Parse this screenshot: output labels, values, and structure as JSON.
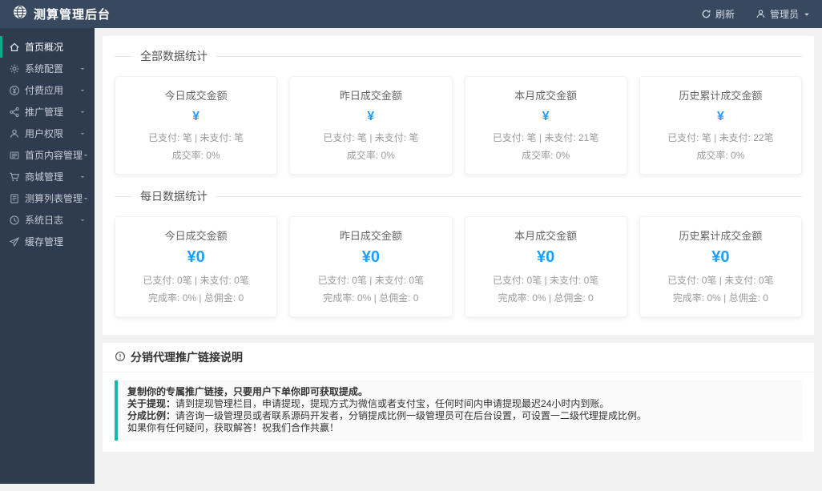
{
  "header": {
    "title": "测算管理后台",
    "refresh_label": "刷新",
    "user_label": "管理员"
  },
  "sidebar": {
    "items": [
      {
        "label": "首页概况",
        "icon": "home-icon",
        "active": true,
        "has_children": false
      },
      {
        "label": "系统配置",
        "icon": "gear-icon",
        "active": false,
        "has_children": true
      },
      {
        "label": "付费应用",
        "icon": "pay-icon",
        "active": false,
        "has_children": true
      },
      {
        "label": "推广管理",
        "icon": "share-icon",
        "active": false,
        "has_children": true
      },
      {
        "label": "用户权限",
        "icon": "user-icon",
        "active": false,
        "has_children": true
      },
      {
        "label": "首页内容管理",
        "icon": "content-icon",
        "active": false,
        "has_children": true
      },
      {
        "label": "商城管理",
        "icon": "cart-icon",
        "active": false,
        "has_children": true
      },
      {
        "label": "测算列表管理",
        "icon": "list-icon",
        "active": false,
        "has_children": true
      },
      {
        "label": "系统日志",
        "icon": "clock-icon",
        "active": false,
        "has_children": true
      },
      {
        "label": "缓存管理",
        "icon": "send-icon",
        "active": false,
        "has_children": false
      }
    ]
  },
  "stats_all": {
    "section_title": "全部数据统计",
    "cards": [
      {
        "title": "今日成交金额",
        "amount": "¥",
        "line1": "已支付: 笔 | 未支付: 笔",
        "line2": "成交率: 0%"
      },
      {
        "title": "昨日成交金额",
        "amount": "¥",
        "line1": "已支付: 笔 | 未支付: 笔",
        "line2": "成交率: 0%"
      },
      {
        "title": "本月成交金额",
        "amount": "¥",
        "line1": "已支付: 笔 | 未支付: 21笔",
        "line2": "成交率: 0%"
      },
      {
        "title": "历史累计成交金额",
        "amount": "¥",
        "line1": "已支付: 笔 | 未支付: 22笔",
        "line2": "成交率: 0%"
      }
    ]
  },
  "stats_daily": {
    "section_title": "每日数据统计",
    "cards": [
      {
        "title": "今日成交金额",
        "amount": "¥0",
        "line1": "已支付: 0笔 | 未支付: 0笔",
        "line2": "完成率: 0% | 总佣金: 0"
      },
      {
        "title": "昨日成交金额",
        "amount": "¥0",
        "line1": "已支付: 0笔 | 未支付: 0笔",
        "line2": "完成率: 0% | 总佣金: 0"
      },
      {
        "title": "本月成交金额",
        "amount": "¥0",
        "line1": "已支付: 0笔 | 未支付: 0笔",
        "line2": "完成率: 0% | 总佣金: 0"
      },
      {
        "title": "历史累计成交金额",
        "amount": "¥0",
        "line1": "已支付: 0笔 | 未支付: 0笔",
        "line2": "完成率: 0% | 总佣金: 0"
      }
    ]
  },
  "notice": {
    "title": "分销代理推广链接说明",
    "line1": "复制你的专属推广链接，只要用户下单你即可获取提成。",
    "line2_label": "关于提现：",
    "line2_text": "请到提现管理栏目，申请提现，提现方式为微信或者支付宝，任何时间内申请提现最迟24小时内到账。",
    "line3_label": "分成比例：",
    "line3_text": "请咨询一级管理员或者联系源码开发者，分销提成比例一级管理员可在后台设置，可设置一二级代理提成比例。",
    "line4": "如果你有任何疑问，获取解答！祝我们合作共赢！"
  },
  "colors": {
    "header_bg": "#37485f",
    "sidebar_bg": "#2f3c50",
    "accent_blue": "#1E9FFF",
    "accent_teal": "#16baaa",
    "active_indicator": "#10ab88",
    "content_bg": "#f2f2f2"
  }
}
